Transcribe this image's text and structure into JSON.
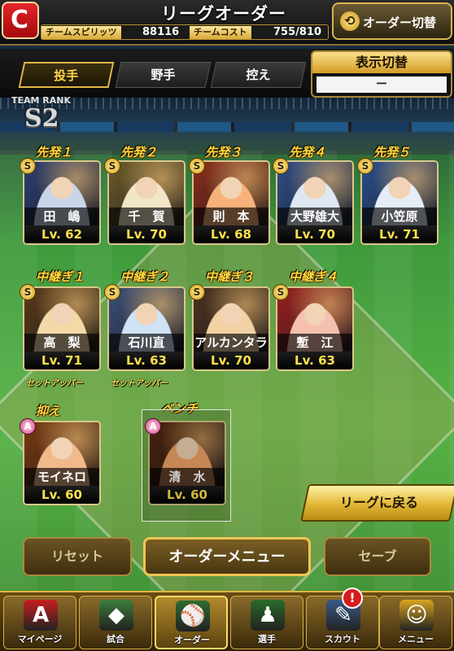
{
  "header": {
    "team_logo": "C",
    "title": "リーグオーダー",
    "team_spirit_label": "チームスピリッツ",
    "team_spirit_value": "88116",
    "team_cost_label": "チームコスト",
    "team_cost_value": "755/810",
    "order_switch_label": "オーダー切替",
    "order_switch_icon": "swap-icon"
  },
  "tabs": [
    {
      "label": "投手",
      "active": true
    },
    {
      "label": "野手",
      "active": false
    },
    {
      "label": "控え",
      "active": false
    }
  ],
  "display_toggle": {
    "label": "表示切替",
    "value": "ー"
  },
  "team_rank": {
    "label": "TEAM RANK",
    "value": "S2"
  },
  "starters": [
    {
      "slot": "先発１",
      "rank": "S",
      "name": "田　嶋",
      "level": "Lv. 62",
      "colors": [
        "#c9d6ea",
        "#2d3f73"
      ]
    },
    {
      "slot": "先発２",
      "rank": "S",
      "name": "千　賀",
      "level": "Lv. 70",
      "colors": [
        "#f2e6c8",
        "#6b5a2a"
      ]
    },
    {
      "slot": "先発３",
      "rank": "S",
      "name": "則　本",
      "level": "Lv. 68",
      "colors": [
        "#f6b27a",
        "#8a2d1a"
      ]
    },
    {
      "slot": "先発４",
      "rank": "S",
      "name": "大野雄大",
      "level": "Lv. 70",
      "colors": [
        "#dfe7f3",
        "#2f4f8a"
      ]
    },
    {
      "slot": "先発５",
      "rank": "S",
      "name": "小笠原",
      "level": "Lv. 71",
      "colors": [
        "#e6edf7",
        "#29508f"
      ]
    }
  ],
  "relievers": [
    {
      "slot": "中継ぎ１",
      "rank": "S",
      "name": "高　梨",
      "level": "Lv. 71",
      "role": "セットアッパー",
      "colors": [
        "#f3d9a8",
        "#5a3a18"
      ]
    },
    {
      "slot": "中継ぎ２",
      "rank": "S",
      "name": "石川直",
      "level": "Lv. 63",
      "role": "セットアッパー",
      "colors": [
        "#cfe2f6",
        "#3a4f7a"
      ]
    },
    {
      "slot": "中継ぎ３",
      "rank": "S",
      "name": "アルカンタラ",
      "level": "Lv. 70",
      "role": "",
      "colors": [
        "#f1d2a4",
        "#4a3220"
      ]
    },
    {
      "slot": "中継ぎ４",
      "rank": "S",
      "name": "塹　江",
      "level": "Lv. 63",
      "role": "",
      "colors": [
        "#f5c0b0",
        "#9a2020"
      ]
    }
  ],
  "closer": {
    "slot": "抑え",
    "rank": "A",
    "name": "モイネロ",
    "level": "Lv. 60",
    "colors": [
      "#f2b98a",
      "#7a3a12"
    ]
  },
  "bench": {
    "slot": "ベンチ",
    "rank": "A",
    "name": "清　水",
    "level": "Lv. 60",
    "colors": [
      "#f2a46a",
      "#5a2a10"
    ]
  },
  "buttons": {
    "back": "リーグに戻る",
    "reset": "リセット",
    "order_menu": "オーダーメニュー",
    "save": "セーブ"
  },
  "nav": [
    {
      "label": "マイページ",
      "icon": "mypage-icon",
      "glyph": "A",
      "color": "#c81e1e",
      "active": false
    },
    {
      "label": "試合",
      "icon": "stadium-icon",
      "glyph": "◆",
      "color": "#3b7d3b",
      "active": false
    },
    {
      "label": "オーダー",
      "icon": "order-icon",
      "glyph": "⚾",
      "color": "#2f6b2f",
      "active": true
    },
    {
      "label": "選手",
      "icon": "player-icon",
      "glyph": "♟",
      "color": "#2a6a2a",
      "active": false
    },
    {
      "label": "スカウト",
      "icon": "scout-icon",
      "glyph": "✎",
      "color": "#3a5b8a",
      "active": false,
      "alert": "!"
    },
    {
      "label": "メニュー",
      "icon": "menu-icon",
      "glyph": "☺",
      "color": "#d9a520",
      "active": false
    }
  ]
}
